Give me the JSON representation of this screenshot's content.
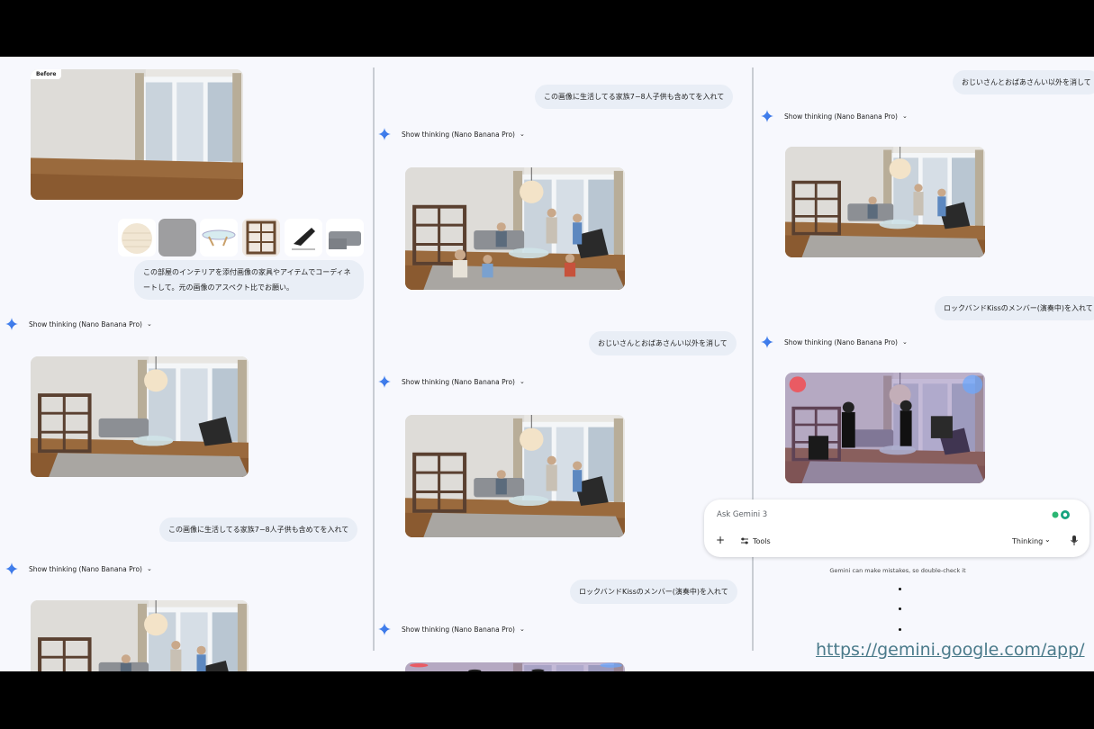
{
  "left": {
    "before_label": "Before",
    "prompt": "この部屋のインテリアを添付画像の家具やアイテムでコーディネートして。元の画像のアスペクト比でお願い。",
    "thinking_1": "Show thinking (Nano Banana Pro)",
    "prompt_2": "この画像に生活してる家族7−8人子供も含めてを入れて",
    "thinking_2": "Show thinking (Nano Banana Pro)"
  },
  "middle": {
    "prompt_1": "この画像に生活してる家族7−8人子供も含めてを入れて",
    "thinking_1": "Show thinking (Nano Banana Pro)",
    "prompt_2": "おじいさんとおばあさんい以外を消して",
    "thinking_2": "Show thinking (Nano Banana Pro)",
    "prompt_3": "ロックバンドKissのメンバー(演奏中)を入れて",
    "thinking_3": "Show thinking (Nano Banana Pro)"
  },
  "right": {
    "prompt_1": "おじいさんとおばあさんい以外を消して",
    "thinking_1": "Show thinking (Nano Banana Pro)",
    "prompt_2": "ロックバンドKissのメンバー(演奏中)を入れて",
    "thinking_2": "Show thinking (Nano Banana Pro)"
  },
  "input": {
    "placeholder": "Ask Gemini 3",
    "tools_label": "Tools",
    "mode_label": "Thinking",
    "disclaimer": "Gemini can make mistakes, so double-check it"
  },
  "footer_url": "https://gemini.google.com/app/",
  "colors": {
    "accent": "#4285f4",
    "bubble": "#e9eef6",
    "link": "#4a7a8a"
  }
}
